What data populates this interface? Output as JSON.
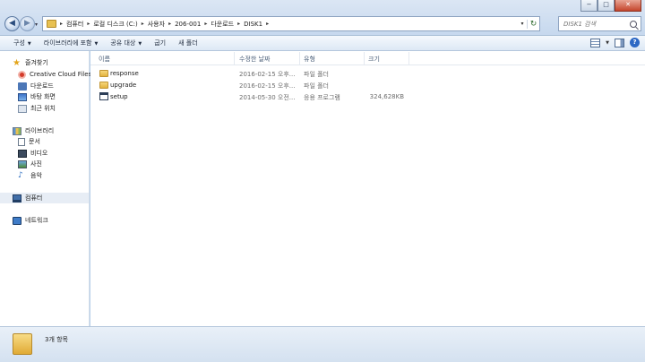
{
  "window": {
    "minimize_label": "−",
    "maximize_label": "□",
    "close_label": "✕"
  },
  "nav": {
    "back_glyph": "◀",
    "forward_glyph": "▶",
    "history_caret": "▾"
  },
  "address": {
    "crumbs": [
      "컴퓨터",
      "로컬 디스크 (C:)",
      "사용자",
      "206-001",
      "다운로드",
      "DISK1"
    ],
    "separator": "▸",
    "refresh_glyph": "↻"
  },
  "search": {
    "placeholder": "DISK1 검색"
  },
  "toolbar": {
    "organize": "구성",
    "include_in_library": "라이브러리에 포함",
    "share_with": "공유 대상",
    "burn": "굽기",
    "new_folder": "새 폴더",
    "help": "?"
  },
  "sidebar": {
    "favorites": {
      "label": "즐겨찾기",
      "items": [
        "Creative Cloud Files",
        "다운로드",
        "바탕 화면",
        "최근 위치"
      ]
    },
    "libraries": {
      "label": "라이브러리",
      "items": [
        "문서",
        "비디오",
        "사진",
        "음악"
      ]
    },
    "computer": {
      "label": "컴퓨터"
    },
    "network": {
      "label": "네트워크"
    }
  },
  "columns": {
    "name": "이름",
    "date": "수정한 날짜",
    "type": "유형",
    "size": "크기"
  },
  "files": [
    {
      "name": "response",
      "date": "2016-02-15 오후...",
      "type": "파일 폴더",
      "size": "",
      "icon": "folder-icon"
    },
    {
      "name": "upgrade",
      "date": "2016-02-15 오후...",
      "type": "파일 폴더",
      "size": "",
      "icon": "folder-icon"
    },
    {
      "name": "setup",
      "date": "2014-05-30 오전...",
      "type": "응용 프로그램",
      "size": "324,628KB",
      "icon": "app-icon"
    }
  ],
  "status": {
    "item_count": "3개 항목"
  }
}
